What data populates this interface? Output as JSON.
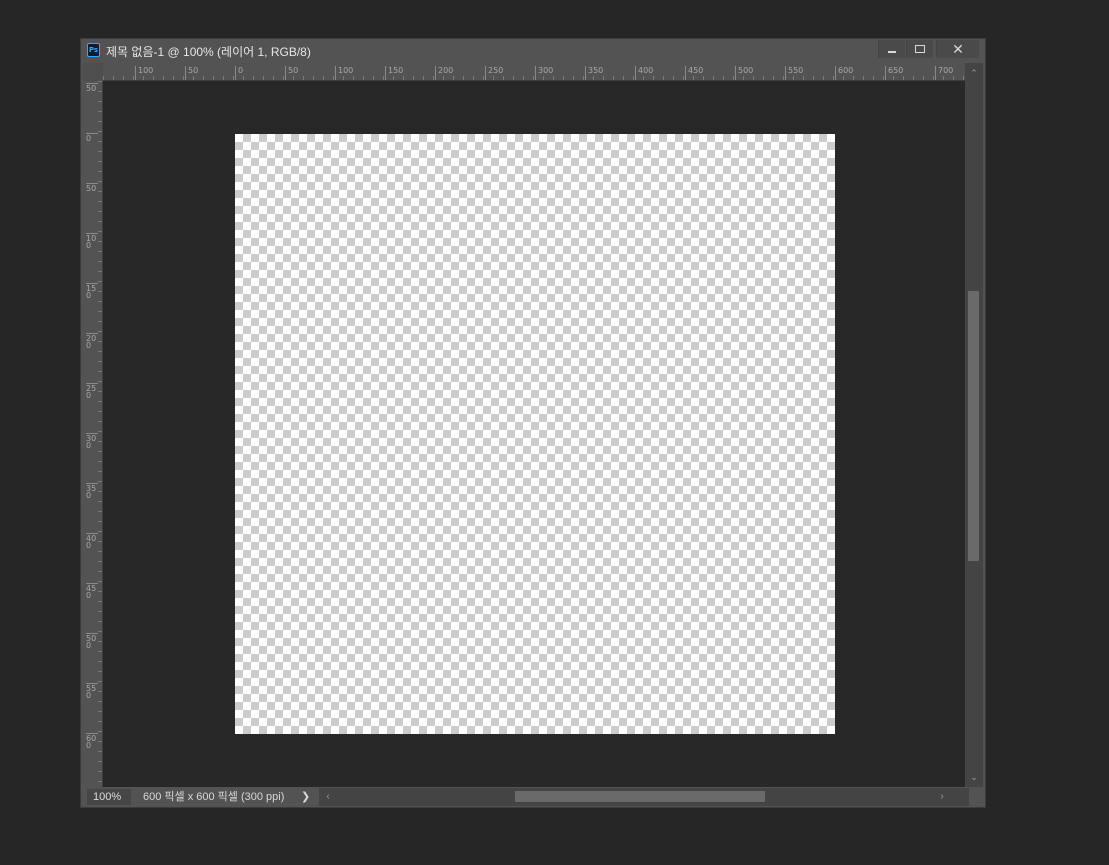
{
  "window": {
    "app_icon_label": "Ps",
    "title": "제목 없음-1 @ 100% (레이어 1, RGB/8)",
    "controls": {
      "close": "✕"
    }
  },
  "ruler_h": {
    "labels": [
      "100",
      "50",
      "0",
      "50",
      "100",
      "150",
      "200",
      "250",
      "300",
      "350",
      "400",
      "450",
      "500",
      "550",
      "600",
      "650",
      "700"
    ]
  },
  "ruler_v": {
    "labels": [
      "50",
      "0",
      "50",
      "100",
      "150",
      "200",
      "250",
      "300",
      "350",
      "400",
      "450",
      "500",
      "550",
      "600"
    ]
  },
  "status": {
    "zoom": "100%",
    "doc_info": "600 픽셀 x 600 픽셀 (300 ppi)",
    "expand_arrow": "❯"
  },
  "scroll": {
    "up": "⌃",
    "down": "⌄",
    "left": "‹",
    "right": "›"
  }
}
